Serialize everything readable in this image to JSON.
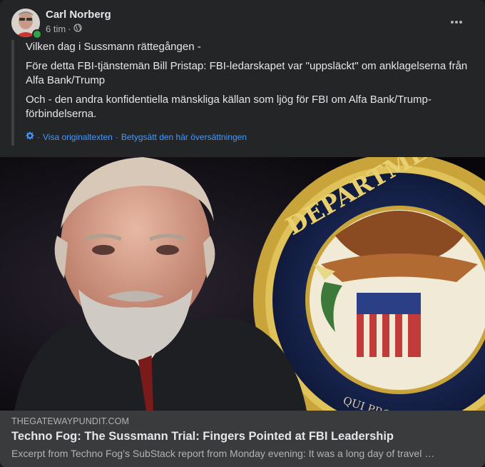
{
  "post": {
    "author": "Carl Norberg",
    "time": "6 tim",
    "dot": "·",
    "privacy_icon": "globe-icon",
    "more_icon": "more-horizontal-icon",
    "body": {
      "line1": "Vilken dag i Sussmann rättegången -",
      "line2": "Före detta FBI-tjänstemän Bill Pristap: FBI-ledarskapet var \"uppsläckt\" om anklagelserna från Alfa Bank/Trump",
      "line3": "Och - den andra konfidentiella mänskliga källan som ljög för FBI om Alfa Bank/Trump-förbindelserna."
    },
    "translation": {
      "icon": "gear-icon",
      "show_original": "Visa originaltexten",
      "separator": "·",
      "rate": "Betygsätt den här översättningen"
    }
  },
  "link_preview": {
    "domain": "THEGATEWAYPUNDIT.COM",
    "headline": "Techno Fog: The Sussmann Trial: Fingers Pointed at FBI Leadership",
    "excerpt": "Excerpt from Techno Fog’s SubStack report from Monday evening: It was a long day of travel …",
    "seal_text": "DEPARTMENT OF JUSTICE",
    "motto": "QUI PRO DOMINA JUSTITIA SEQUITUR"
  },
  "colors": {
    "card_bg": "#242526",
    "text_primary": "#e4e6eb",
    "text_secondary": "#b0b3b8",
    "link_blue": "#4599ff",
    "online_green": "#31a24c"
  }
}
